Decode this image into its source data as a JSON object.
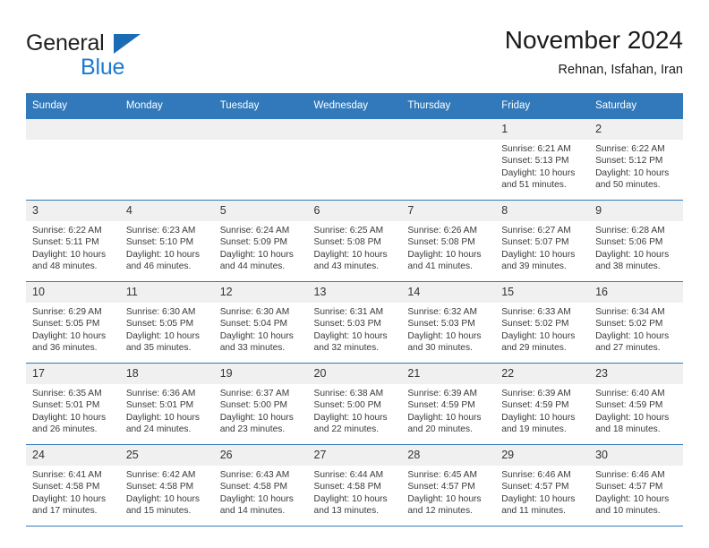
{
  "brand": {
    "word1": "General",
    "word2": "Blue",
    "triangle_color": "#1b6cb5",
    "blue_color": "#1b7ad1"
  },
  "header": {
    "title": "November 2024",
    "subtitle": "Rehnan, Isfahan, Iran"
  },
  "theme": {
    "header_blue": "#3179ba",
    "daynum_bg": "#f0f0f0"
  },
  "weekdays": [
    "Sunday",
    "Monday",
    "Tuesday",
    "Wednesday",
    "Thursday",
    "Friday",
    "Saturday"
  ],
  "weeks": [
    [
      {
        "day": "",
        "sunrise": "",
        "sunset": "",
        "daylight": "",
        "daylight2": ""
      },
      {
        "day": "",
        "sunrise": "",
        "sunset": "",
        "daylight": "",
        "daylight2": ""
      },
      {
        "day": "",
        "sunrise": "",
        "sunset": "",
        "daylight": "",
        "daylight2": ""
      },
      {
        "day": "",
        "sunrise": "",
        "sunset": "",
        "daylight": "",
        "daylight2": ""
      },
      {
        "day": "",
        "sunrise": "",
        "sunset": "",
        "daylight": "",
        "daylight2": ""
      },
      {
        "day": "1",
        "sunrise": "Sunrise: 6:21 AM",
        "sunset": "Sunset: 5:13 PM",
        "daylight": "Daylight: 10 hours",
        "daylight2": "and 51 minutes."
      },
      {
        "day": "2",
        "sunrise": "Sunrise: 6:22 AM",
        "sunset": "Sunset: 5:12 PM",
        "daylight": "Daylight: 10 hours",
        "daylight2": "and 50 minutes."
      }
    ],
    [
      {
        "day": "3",
        "sunrise": "Sunrise: 6:22 AM",
        "sunset": "Sunset: 5:11 PM",
        "daylight": "Daylight: 10 hours",
        "daylight2": "and 48 minutes."
      },
      {
        "day": "4",
        "sunrise": "Sunrise: 6:23 AM",
        "sunset": "Sunset: 5:10 PM",
        "daylight": "Daylight: 10 hours",
        "daylight2": "and 46 minutes."
      },
      {
        "day": "5",
        "sunrise": "Sunrise: 6:24 AM",
        "sunset": "Sunset: 5:09 PM",
        "daylight": "Daylight: 10 hours",
        "daylight2": "and 44 minutes."
      },
      {
        "day": "6",
        "sunrise": "Sunrise: 6:25 AM",
        "sunset": "Sunset: 5:08 PM",
        "daylight": "Daylight: 10 hours",
        "daylight2": "and 43 minutes."
      },
      {
        "day": "7",
        "sunrise": "Sunrise: 6:26 AM",
        "sunset": "Sunset: 5:08 PM",
        "daylight": "Daylight: 10 hours",
        "daylight2": "and 41 minutes."
      },
      {
        "day": "8",
        "sunrise": "Sunrise: 6:27 AM",
        "sunset": "Sunset: 5:07 PM",
        "daylight": "Daylight: 10 hours",
        "daylight2": "and 39 minutes."
      },
      {
        "day": "9",
        "sunrise": "Sunrise: 6:28 AM",
        "sunset": "Sunset: 5:06 PM",
        "daylight": "Daylight: 10 hours",
        "daylight2": "and 38 minutes."
      }
    ],
    [
      {
        "day": "10",
        "sunrise": "Sunrise: 6:29 AM",
        "sunset": "Sunset: 5:05 PM",
        "daylight": "Daylight: 10 hours",
        "daylight2": "and 36 minutes."
      },
      {
        "day": "11",
        "sunrise": "Sunrise: 6:30 AM",
        "sunset": "Sunset: 5:05 PM",
        "daylight": "Daylight: 10 hours",
        "daylight2": "and 35 minutes."
      },
      {
        "day": "12",
        "sunrise": "Sunrise: 6:30 AM",
        "sunset": "Sunset: 5:04 PM",
        "daylight": "Daylight: 10 hours",
        "daylight2": "and 33 minutes."
      },
      {
        "day": "13",
        "sunrise": "Sunrise: 6:31 AM",
        "sunset": "Sunset: 5:03 PM",
        "daylight": "Daylight: 10 hours",
        "daylight2": "and 32 minutes."
      },
      {
        "day": "14",
        "sunrise": "Sunrise: 6:32 AM",
        "sunset": "Sunset: 5:03 PM",
        "daylight": "Daylight: 10 hours",
        "daylight2": "and 30 minutes."
      },
      {
        "day": "15",
        "sunrise": "Sunrise: 6:33 AM",
        "sunset": "Sunset: 5:02 PM",
        "daylight": "Daylight: 10 hours",
        "daylight2": "and 29 minutes."
      },
      {
        "day": "16",
        "sunrise": "Sunrise: 6:34 AM",
        "sunset": "Sunset: 5:02 PM",
        "daylight": "Daylight: 10 hours",
        "daylight2": "and 27 minutes."
      }
    ],
    [
      {
        "day": "17",
        "sunrise": "Sunrise: 6:35 AM",
        "sunset": "Sunset: 5:01 PM",
        "daylight": "Daylight: 10 hours",
        "daylight2": "and 26 minutes."
      },
      {
        "day": "18",
        "sunrise": "Sunrise: 6:36 AM",
        "sunset": "Sunset: 5:01 PM",
        "daylight": "Daylight: 10 hours",
        "daylight2": "and 24 minutes."
      },
      {
        "day": "19",
        "sunrise": "Sunrise: 6:37 AM",
        "sunset": "Sunset: 5:00 PM",
        "daylight": "Daylight: 10 hours",
        "daylight2": "and 23 minutes."
      },
      {
        "day": "20",
        "sunrise": "Sunrise: 6:38 AM",
        "sunset": "Sunset: 5:00 PM",
        "daylight": "Daylight: 10 hours",
        "daylight2": "and 22 minutes."
      },
      {
        "day": "21",
        "sunrise": "Sunrise: 6:39 AM",
        "sunset": "Sunset: 4:59 PM",
        "daylight": "Daylight: 10 hours",
        "daylight2": "and 20 minutes."
      },
      {
        "day": "22",
        "sunrise": "Sunrise: 6:39 AM",
        "sunset": "Sunset: 4:59 PM",
        "daylight": "Daylight: 10 hours",
        "daylight2": "and 19 minutes."
      },
      {
        "day": "23",
        "sunrise": "Sunrise: 6:40 AM",
        "sunset": "Sunset: 4:59 PM",
        "daylight": "Daylight: 10 hours",
        "daylight2": "and 18 minutes."
      }
    ],
    [
      {
        "day": "24",
        "sunrise": "Sunrise: 6:41 AM",
        "sunset": "Sunset: 4:58 PM",
        "daylight": "Daylight: 10 hours",
        "daylight2": "and 17 minutes."
      },
      {
        "day": "25",
        "sunrise": "Sunrise: 6:42 AM",
        "sunset": "Sunset: 4:58 PM",
        "daylight": "Daylight: 10 hours",
        "daylight2": "and 15 minutes."
      },
      {
        "day": "26",
        "sunrise": "Sunrise: 6:43 AM",
        "sunset": "Sunset: 4:58 PM",
        "daylight": "Daylight: 10 hours",
        "daylight2": "and 14 minutes."
      },
      {
        "day": "27",
        "sunrise": "Sunrise: 6:44 AM",
        "sunset": "Sunset: 4:58 PM",
        "daylight": "Daylight: 10 hours",
        "daylight2": "and 13 minutes."
      },
      {
        "day": "28",
        "sunrise": "Sunrise: 6:45 AM",
        "sunset": "Sunset: 4:57 PM",
        "daylight": "Daylight: 10 hours",
        "daylight2": "and 12 minutes."
      },
      {
        "day": "29",
        "sunrise": "Sunrise: 6:46 AM",
        "sunset": "Sunset: 4:57 PM",
        "daylight": "Daylight: 10 hours",
        "daylight2": "and 11 minutes."
      },
      {
        "day": "30",
        "sunrise": "Sunrise: 6:46 AM",
        "sunset": "Sunset: 4:57 PM",
        "daylight": "Daylight: 10 hours",
        "daylight2": "and 10 minutes."
      }
    ]
  ]
}
